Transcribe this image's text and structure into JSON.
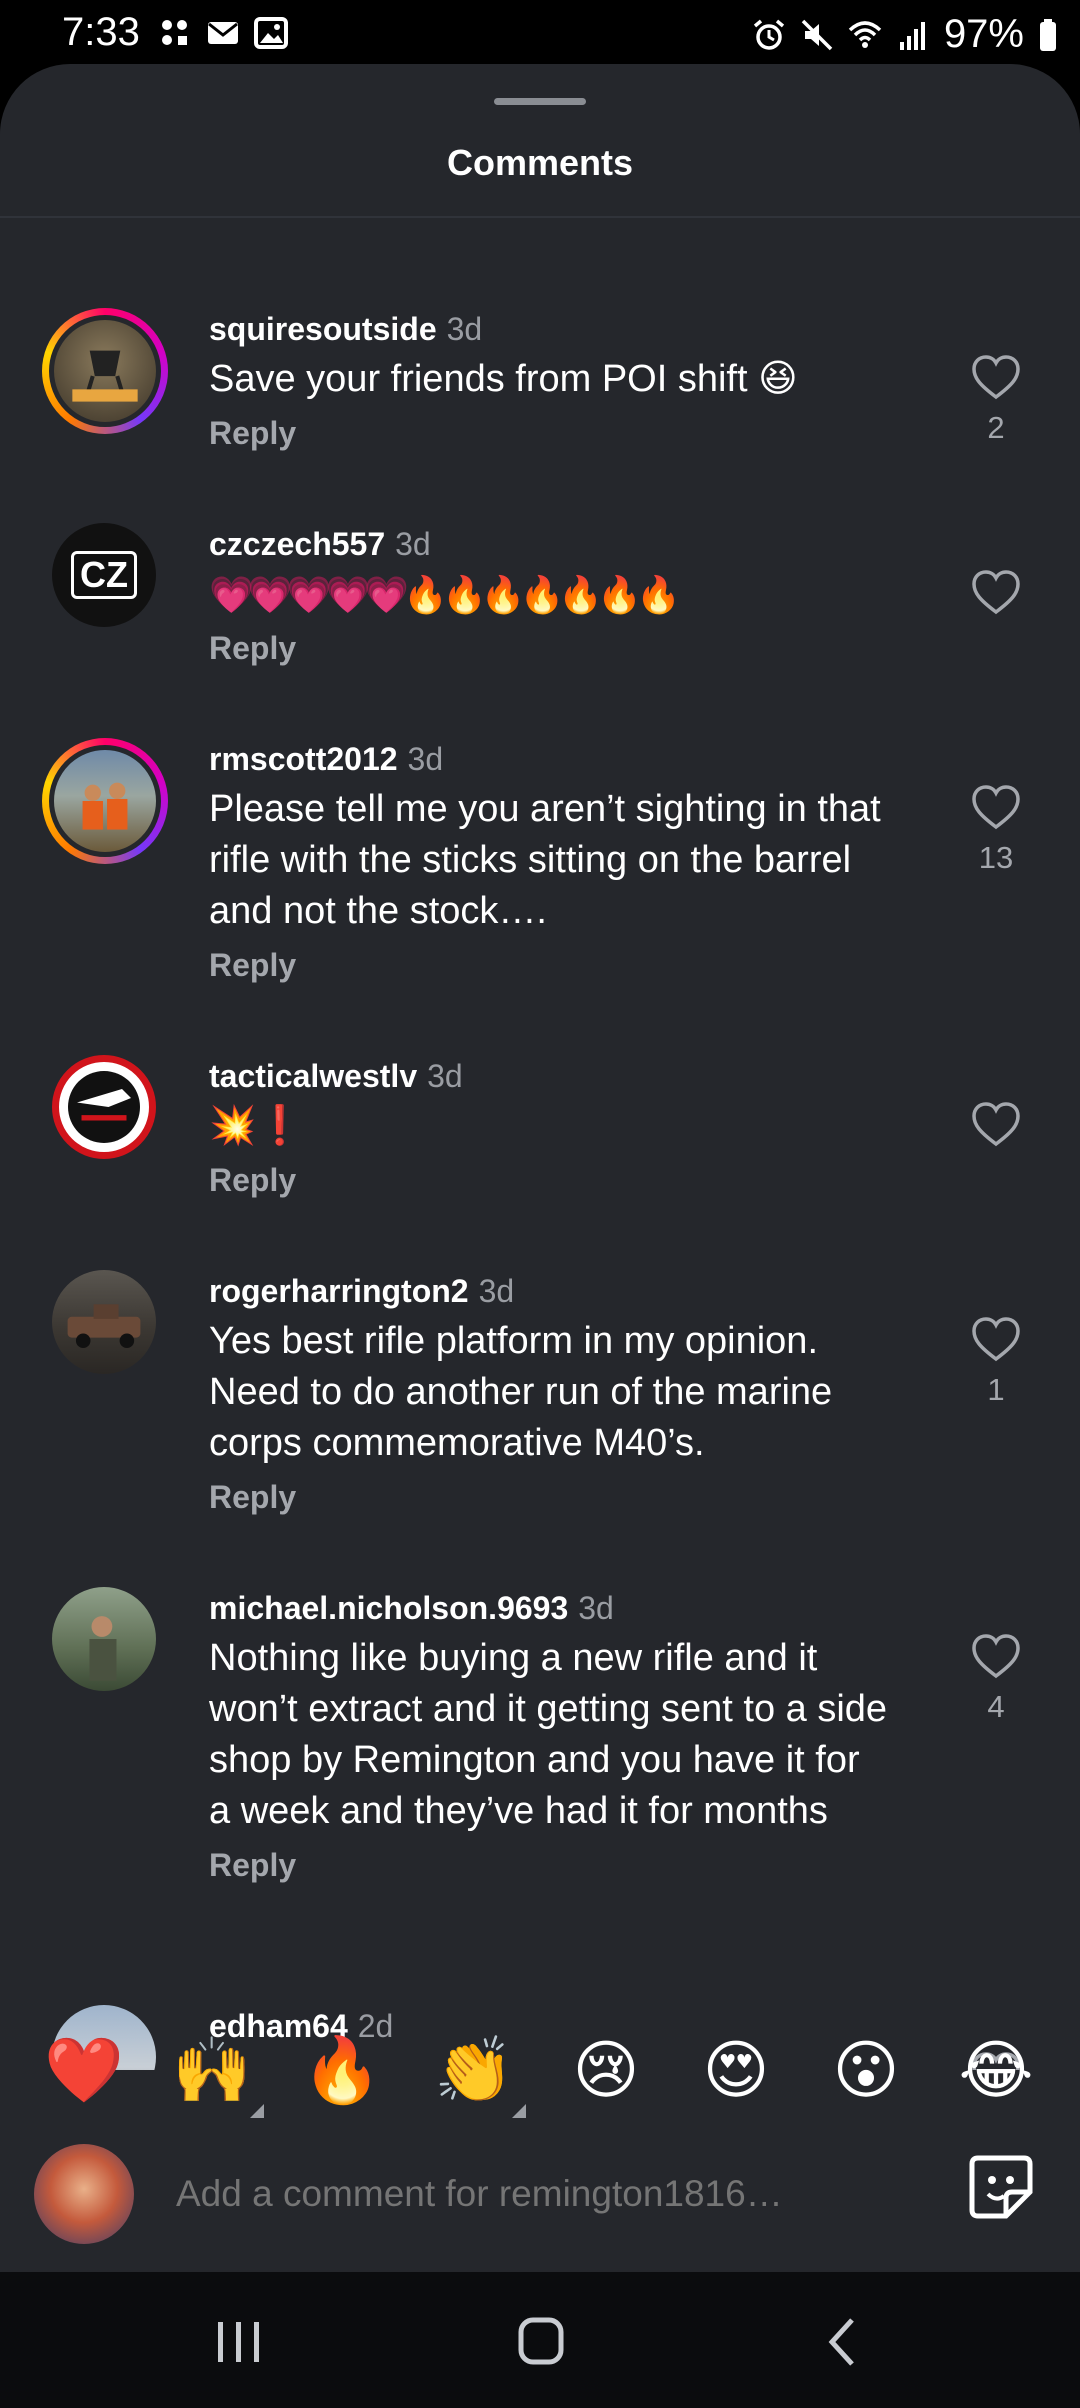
{
  "status_bar": {
    "time": "7:33",
    "battery": "97%",
    "left_icons": [
      "app-notification-icon",
      "mail-icon",
      "gallery-icon"
    ],
    "right_icons": [
      "alarm-icon",
      "mute-icon",
      "wifi-icon",
      "signal-icon",
      "battery-icon"
    ]
  },
  "sheet": {
    "title": "Comments"
  },
  "comments": [
    {
      "user": "squiresoutside",
      "time": "3d",
      "text": "Save your friends from POI shift 😆",
      "reply": "Reply",
      "likes": "2",
      "avatar_ring": true
    },
    {
      "user": "czczech557",
      "time": "3d",
      "text": "💗💗💗💗💗🔥🔥🔥🔥🔥🔥🔥",
      "reply": "Reply",
      "likes": "",
      "avatar_ring": false,
      "avatar_text": "CZ"
    },
    {
      "user": "rmscott2012",
      "time": "3d",
      "text": "Please tell me you aren’t sighting in that rifle with the sticks sitting on the barrel and not the stock….",
      "reply": "Reply",
      "likes": "13",
      "avatar_ring": true
    },
    {
      "user": "tacticalwestlv",
      "time": "3d",
      "text": "💥❗",
      "reply": "Reply",
      "likes": "",
      "avatar_ring": false
    },
    {
      "user": "rogerharrington2",
      "time": "3d",
      "text": "Yes best rifle platform in my opinion. Need to do another run of the marine corps commemorative  M40’s.",
      "reply": "Reply",
      "likes": "1",
      "avatar_ring": false
    },
    {
      "user": "michael.nicholson.9693",
      "time": "3d",
      "text": "Nothing like buying a new rifle and it won’t extract and it getting sent to a side shop by Remington and you have it for a week and they’ve had it for months",
      "reply": "Reply",
      "likes": "4",
      "avatar_ring": false
    },
    {
      "user": "edham64",
      "time": "2d",
      "text": "",
      "reply": "",
      "likes": "",
      "avatar_ring": false
    }
  ],
  "emoji_bar": [
    {
      "emoji": "❤️",
      "name": "heart-emoji",
      "has_variants": false
    },
    {
      "emoji": "🙌",
      "name": "raising-hands-emoji",
      "has_variants": true
    },
    {
      "emoji": "🔥",
      "name": "fire-emoji",
      "has_variants": false
    },
    {
      "emoji": "👏",
      "name": "clapping-emoji",
      "has_variants": true
    },
    {
      "emoji": "😢",
      "name": "crying-emoji",
      "has_variants": false
    },
    {
      "emoji": "😍",
      "name": "heart-eyes-emoji",
      "has_variants": false
    },
    {
      "emoji": "😮",
      "name": "surprised-emoji",
      "has_variants": false
    },
    {
      "emoji": "😂",
      "name": "laughing-emoji",
      "has_variants": false
    }
  ],
  "composer": {
    "placeholder": "Add a comment for remington1816…"
  },
  "nav": {
    "icons": [
      "recent-apps-icon",
      "home-icon",
      "back-icon"
    ]
  }
}
